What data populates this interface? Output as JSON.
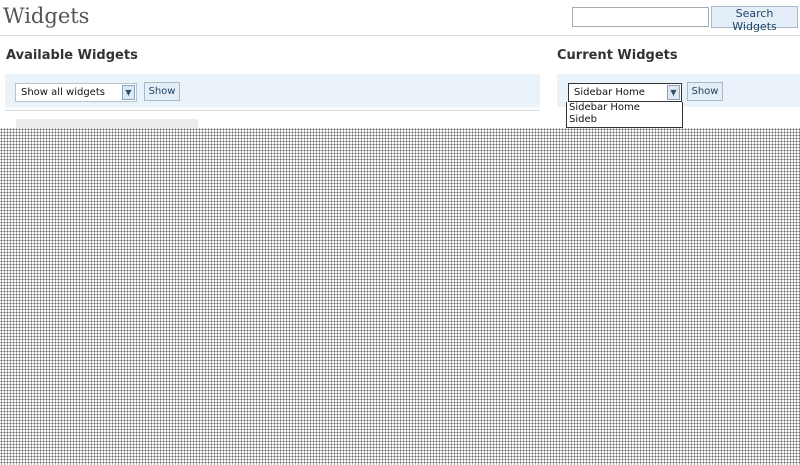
{
  "header": {
    "title": "Widgets",
    "search_placeholder": "",
    "search_button": "Search Widgets"
  },
  "available": {
    "heading": "Available Widgets",
    "filter_selected": "Show all widgets",
    "show_button": "Show"
  },
  "current": {
    "heading": "Current Widgets",
    "sidebar_selected": "Sidebar Home",
    "show_button": "Show",
    "dropdown_options": [
      "Sidebar Home",
      "Sideb"
    ]
  },
  "icons": {
    "dropdown_arrow": "chevron-down-icon"
  },
  "colors": {
    "accent_bar": "#eaf3fa",
    "button_bg": "#e4eef8"
  }
}
